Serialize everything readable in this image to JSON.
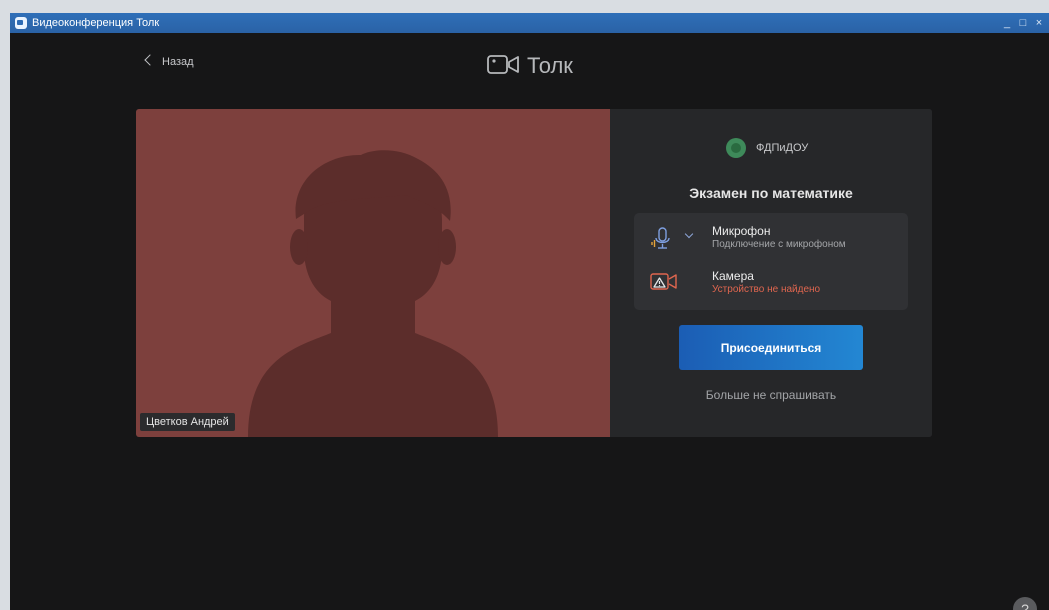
{
  "window": {
    "title": "Видеоконференция Толк",
    "controls": {
      "minimize": "_",
      "maximize": "□",
      "close": "×"
    }
  },
  "header": {
    "back_label": "Назад",
    "brand_name": "Толк"
  },
  "preview": {
    "participant_name": "Цветков Андрей"
  },
  "panel": {
    "organization": "ФДПиДОУ",
    "meeting_title": "Экзамен по математике",
    "microphone": {
      "name": "Микрофон",
      "status": "Подключение с микрофоном",
      "icon": "microphone-icon"
    },
    "camera": {
      "name": "Камера",
      "status": "Устройство не найдено",
      "icon": "camera-warning-icon"
    },
    "join_label": "Присоединиться",
    "dont_ask_label": "Больше не спрашивать"
  },
  "help_label": "?",
  "colors": {
    "accent": "#2387d3",
    "error": "#e0664f",
    "preview_bg": "#7d403d",
    "app_bg": "#161617"
  }
}
